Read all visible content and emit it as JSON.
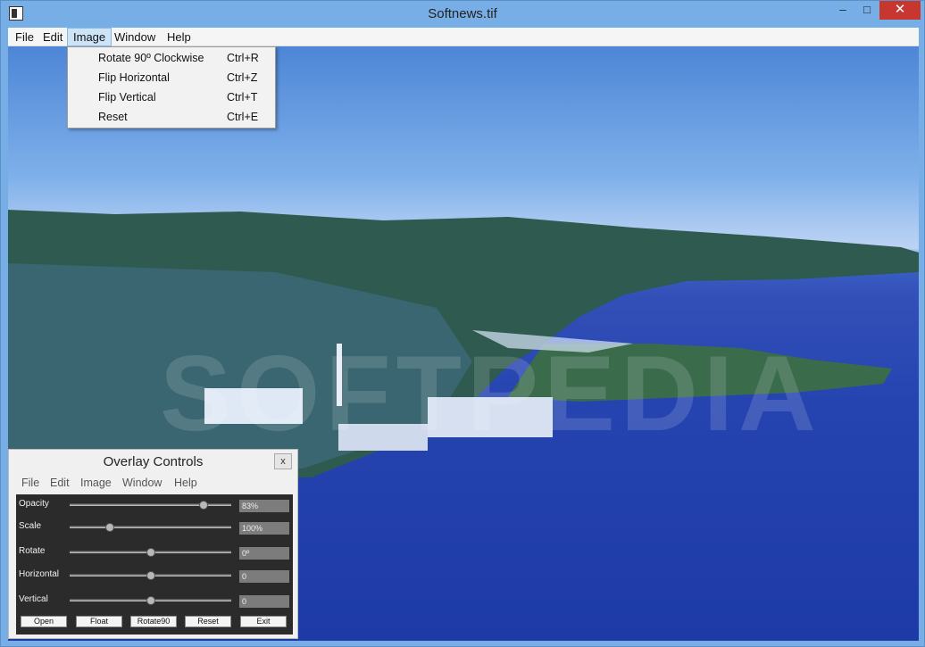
{
  "window": {
    "title": "Softnews.tif",
    "minimize": "–",
    "maximize": "□",
    "close": "✕"
  },
  "menubar": {
    "items": [
      "File",
      "Edit",
      "Image",
      "Window",
      "Help"
    ]
  },
  "image_menu": {
    "items": [
      {
        "label": "Rotate 90º Clockwise",
        "shortcut": "Ctrl+R"
      },
      {
        "label": "Flip Horizontal",
        "shortcut": "Ctrl+Z"
      },
      {
        "label": "Flip Vertical",
        "shortcut": "Ctrl+T"
      },
      {
        "label": "Reset",
        "shortcut": "Ctrl+E"
      }
    ]
  },
  "watermark": "SOFTPEDIA",
  "overlay": {
    "title": "Overlay Controls",
    "close": "x",
    "menu": [
      "File",
      "Edit",
      "Image",
      "Window",
      "Help"
    ],
    "controls": [
      {
        "label": "Opacity",
        "value": "83%",
        "level": 0.83
      },
      {
        "label": "Scale",
        "value": "100%",
        "level": 0.25
      },
      {
        "label": "Rotate",
        "value": "0º",
        "level": 0.5
      },
      {
        "label": "Horizontal",
        "value": "0",
        "level": 0.5
      },
      {
        "label": "Vertical",
        "value": "0",
        "level": 0.5
      }
    ],
    "buttons": [
      "Open",
      "Float",
      "Rotate90",
      "Reset",
      "Exit"
    ]
  },
  "colors": {
    "close_red": "#c7372f",
    "menu_highlight": "#cde4f7",
    "panel_dark": "#2b2b2b"
  }
}
